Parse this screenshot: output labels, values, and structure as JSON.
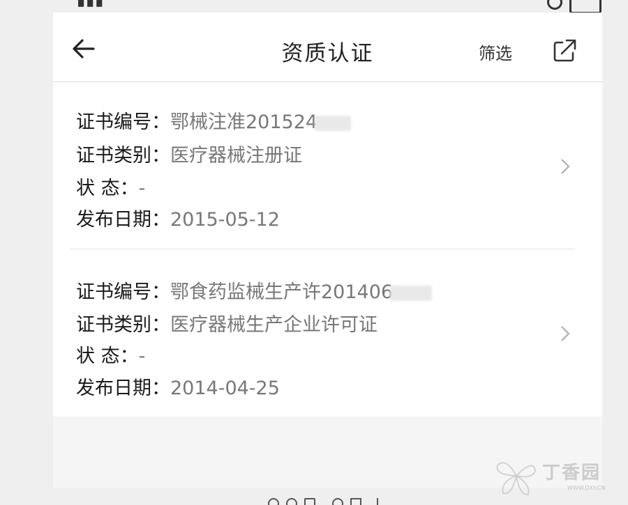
{
  "header": {
    "title": "资质认证",
    "filter_label": "筛选"
  },
  "labels": {
    "cert_no": "证书编号：",
    "cert_type": "证书类别：",
    "status": "状 态：",
    "publish_date": "发布日期："
  },
  "items": [
    {
      "cert_no": "鄂械注准201524",
      "cert_type": "医疗器械注册证",
      "status": "-",
      "publish_date": "2015-05-12"
    },
    {
      "cert_no": "鄂食药监械生产许201406",
      "cert_type": "医疗器械生产企业许可证",
      "status": "-",
      "publish_date": "2014-04-25"
    }
  ],
  "watermark": {
    "brand": "丁香园",
    "url": "WWW.DXY.CN"
  },
  "icons": {
    "back": "arrow-left-icon",
    "share": "share-icon",
    "chevron": "chevron-right-icon"
  },
  "colors": {
    "header_bg": "#ffffff",
    "page_bg": "#f5f5f5",
    "label": "#1a1a1a",
    "value": "#777777"
  }
}
